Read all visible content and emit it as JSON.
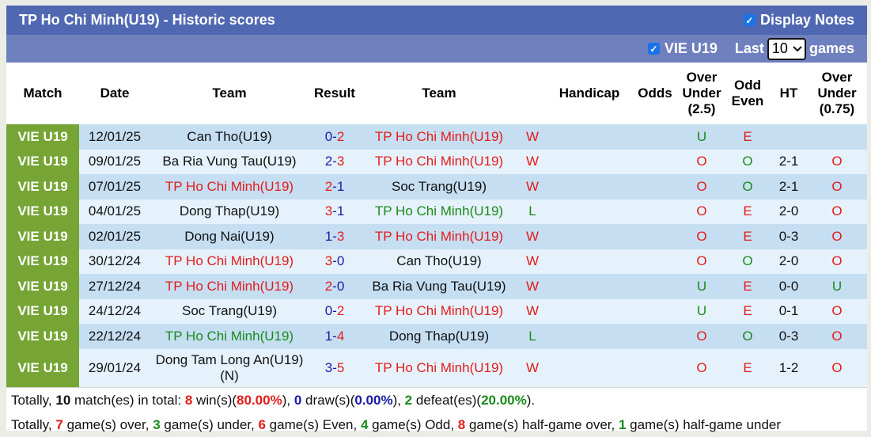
{
  "header": {
    "title": "TP Ho Chi Minh(U19) - Historic scores",
    "display_notes_label": "Display Notes",
    "display_notes_checked": true
  },
  "filter": {
    "league_label": "VIE U19",
    "league_checked": true,
    "last_label": "Last",
    "last_value": "10",
    "games_label": "games"
  },
  "columns": [
    "Match",
    "Date",
    "Team",
    "Result",
    "Team",
    "Handicap",
    "Odds",
    "Over Under (2.5)",
    "Odd Even",
    "HT",
    "Over Under (0.75)"
  ],
  "colors": {
    "red": "#e41b1b",
    "green": "#1a8a1a",
    "blue": "#1a1aa6",
    "league_bg": "#76a535",
    "title_bg": "#5068b2"
  },
  "rows": [
    {
      "match": "VIE U19",
      "date": "12/01/25",
      "home": "Can Tho(U19)",
      "home_color": "blk",
      "score_h": "0",
      "score_a": "2",
      "sh_color": "blue",
      "sa_color": "red",
      "away": "TP Ho Chi Minh(U19)",
      "away_color": "red",
      "result": "W",
      "result_color": "red",
      "handicap": "",
      "odds": "",
      "ou": "U",
      "ou_color": "green",
      "oe": "E",
      "oe_color": "red",
      "ht": "",
      "ht_ou": "",
      "ht_ou_color": "red"
    },
    {
      "match": "VIE U19",
      "date": "09/01/25",
      "home": "Ba Ria Vung Tau(U19)",
      "home_color": "blk",
      "score_h": "2",
      "score_a": "3",
      "sh_color": "blue",
      "sa_color": "red",
      "away": "TP Ho Chi Minh(U19)",
      "away_color": "red",
      "result": "W",
      "result_color": "red",
      "handicap": "",
      "odds": "",
      "ou": "O",
      "ou_color": "red",
      "oe": "O",
      "oe_color": "green",
      "ht": "2-1",
      "ht_ou": "O",
      "ht_ou_color": "red"
    },
    {
      "match": "VIE U19",
      "date": "07/01/25",
      "home": "TP Ho Chi Minh(U19)",
      "home_color": "red",
      "score_h": "2",
      "score_a": "1",
      "sh_color": "red",
      "sa_color": "blue",
      "away": "Soc Trang(U19)",
      "away_color": "blk",
      "result": "W",
      "result_color": "red",
      "handicap": "",
      "odds": "",
      "ou": "O",
      "ou_color": "red",
      "oe": "O",
      "oe_color": "green",
      "ht": "2-1",
      "ht_ou": "O",
      "ht_ou_color": "red"
    },
    {
      "match": "VIE U19",
      "date": "04/01/25",
      "home": "Dong Thap(U19)",
      "home_color": "blk",
      "score_h": "3",
      "score_a": "1",
      "sh_color": "red",
      "sa_color": "blue",
      "away": "TP Ho Chi Minh(U19)",
      "away_color": "green",
      "result": "L",
      "result_color": "green",
      "handicap": "",
      "odds": "",
      "ou": "O",
      "ou_color": "red",
      "oe": "E",
      "oe_color": "red",
      "ht": "2-0",
      "ht_ou": "O",
      "ht_ou_color": "red"
    },
    {
      "match": "VIE U19",
      "date": "02/01/25",
      "home": "Dong Nai(U19)",
      "home_color": "blk",
      "score_h": "1",
      "score_a": "3",
      "sh_color": "blue",
      "sa_color": "red",
      "away": "TP Ho Chi Minh(U19)",
      "away_color": "red",
      "result": "W",
      "result_color": "red",
      "handicap": "",
      "odds": "",
      "ou": "O",
      "ou_color": "red",
      "oe": "E",
      "oe_color": "red",
      "ht": "0-3",
      "ht_ou": "O",
      "ht_ou_color": "red"
    },
    {
      "match": "VIE U19",
      "date": "30/12/24",
      "home": "TP Ho Chi Minh(U19)",
      "home_color": "red",
      "score_h": "3",
      "score_a": "0",
      "sh_color": "red",
      "sa_color": "blue",
      "away": "Can Tho(U19)",
      "away_color": "blk",
      "result": "W",
      "result_color": "red",
      "handicap": "",
      "odds": "",
      "ou": "O",
      "ou_color": "red",
      "oe": "O",
      "oe_color": "green",
      "ht": "2-0",
      "ht_ou": "O",
      "ht_ou_color": "red"
    },
    {
      "match": "VIE U19",
      "date": "27/12/24",
      "home": "TP Ho Chi Minh(U19)",
      "home_color": "red",
      "score_h": "2",
      "score_a": "0",
      "sh_color": "red",
      "sa_color": "blue",
      "away": "Ba Ria Vung Tau(U19)",
      "away_color": "blk",
      "result": "W",
      "result_color": "red",
      "handicap": "",
      "odds": "",
      "ou": "U",
      "ou_color": "green",
      "oe": "E",
      "oe_color": "red",
      "ht": "0-0",
      "ht_ou": "U",
      "ht_ou_color": "green"
    },
    {
      "match": "VIE U19",
      "date": "24/12/24",
      "home": "Soc Trang(U19)",
      "home_color": "blk",
      "score_h": "0",
      "score_a": "2",
      "sh_color": "blue",
      "sa_color": "red",
      "away": "TP Ho Chi Minh(U19)",
      "away_color": "red",
      "result": "W",
      "result_color": "red",
      "handicap": "",
      "odds": "",
      "ou": "U",
      "ou_color": "green",
      "oe": "E",
      "oe_color": "red",
      "ht": "0-1",
      "ht_ou": "O",
      "ht_ou_color": "red"
    },
    {
      "match": "VIE U19",
      "date": "22/12/24",
      "home": "TP Ho Chi Minh(U19)",
      "home_color": "green",
      "score_h": "1",
      "score_a": "4",
      "sh_color": "blue",
      "sa_color": "red",
      "away": "Dong Thap(U19)",
      "away_color": "blk",
      "result": "L",
      "result_color": "green",
      "handicap": "",
      "odds": "",
      "ou": "O",
      "ou_color": "red",
      "oe": "O",
      "oe_color": "green",
      "ht": "0-3",
      "ht_ou": "O",
      "ht_ou_color": "red"
    },
    {
      "match": "VIE U19",
      "date": "29/01/24",
      "home": "Dong Tam Long An(U19) (N)",
      "home_color": "blk",
      "score_h": "3",
      "score_a": "5",
      "sh_color": "blue",
      "sa_color": "red",
      "away": "TP Ho Chi Minh(U19)",
      "away_color": "red",
      "result": "W",
      "result_color": "red",
      "handicap": "",
      "odds": "",
      "ou": "O",
      "ou_color": "red",
      "oe": "E",
      "oe_color": "red",
      "ht": "1-2",
      "ht_ou": "O",
      "ht_ou_color": "red"
    }
  ],
  "summary1": [
    {
      "t": "Totally, ",
      "c": ""
    },
    {
      "t": "10",
      "c": "b"
    },
    {
      "t": " match(es) in total: ",
      "c": ""
    },
    {
      "t": "8",
      "c": "red"
    },
    {
      "t": " win(s)(",
      "c": ""
    },
    {
      "t": "80.00%",
      "c": "red"
    },
    {
      "t": "), ",
      "c": ""
    },
    {
      "t": "0",
      "c": "blue"
    },
    {
      "t": " draw(s)(",
      "c": ""
    },
    {
      "t": "0.00%",
      "c": "blue"
    },
    {
      "t": "), ",
      "c": ""
    },
    {
      "t": "2",
      "c": "green"
    },
    {
      "t": " defeat(es)(",
      "c": ""
    },
    {
      "t": "20.00%",
      "c": "green"
    },
    {
      "t": ").",
      "c": ""
    }
  ],
  "summary2": [
    {
      "t": "Totally, ",
      "c": ""
    },
    {
      "t": "7",
      "c": "red"
    },
    {
      "t": " game(s) over, ",
      "c": ""
    },
    {
      "t": "3",
      "c": "green"
    },
    {
      "t": " game(s) under, ",
      "c": ""
    },
    {
      "t": "6",
      "c": "red"
    },
    {
      "t": " game(s) Even, ",
      "c": ""
    },
    {
      "t": "4",
      "c": "green"
    },
    {
      "t": " game(s) Odd, ",
      "c": ""
    },
    {
      "t": "8",
      "c": "red"
    },
    {
      "t": " game(s) half-game over, ",
      "c": ""
    },
    {
      "t": "1",
      "c": "green"
    },
    {
      "t": " game(s) half-game under",
      "c": ""
    }
  ]
}
